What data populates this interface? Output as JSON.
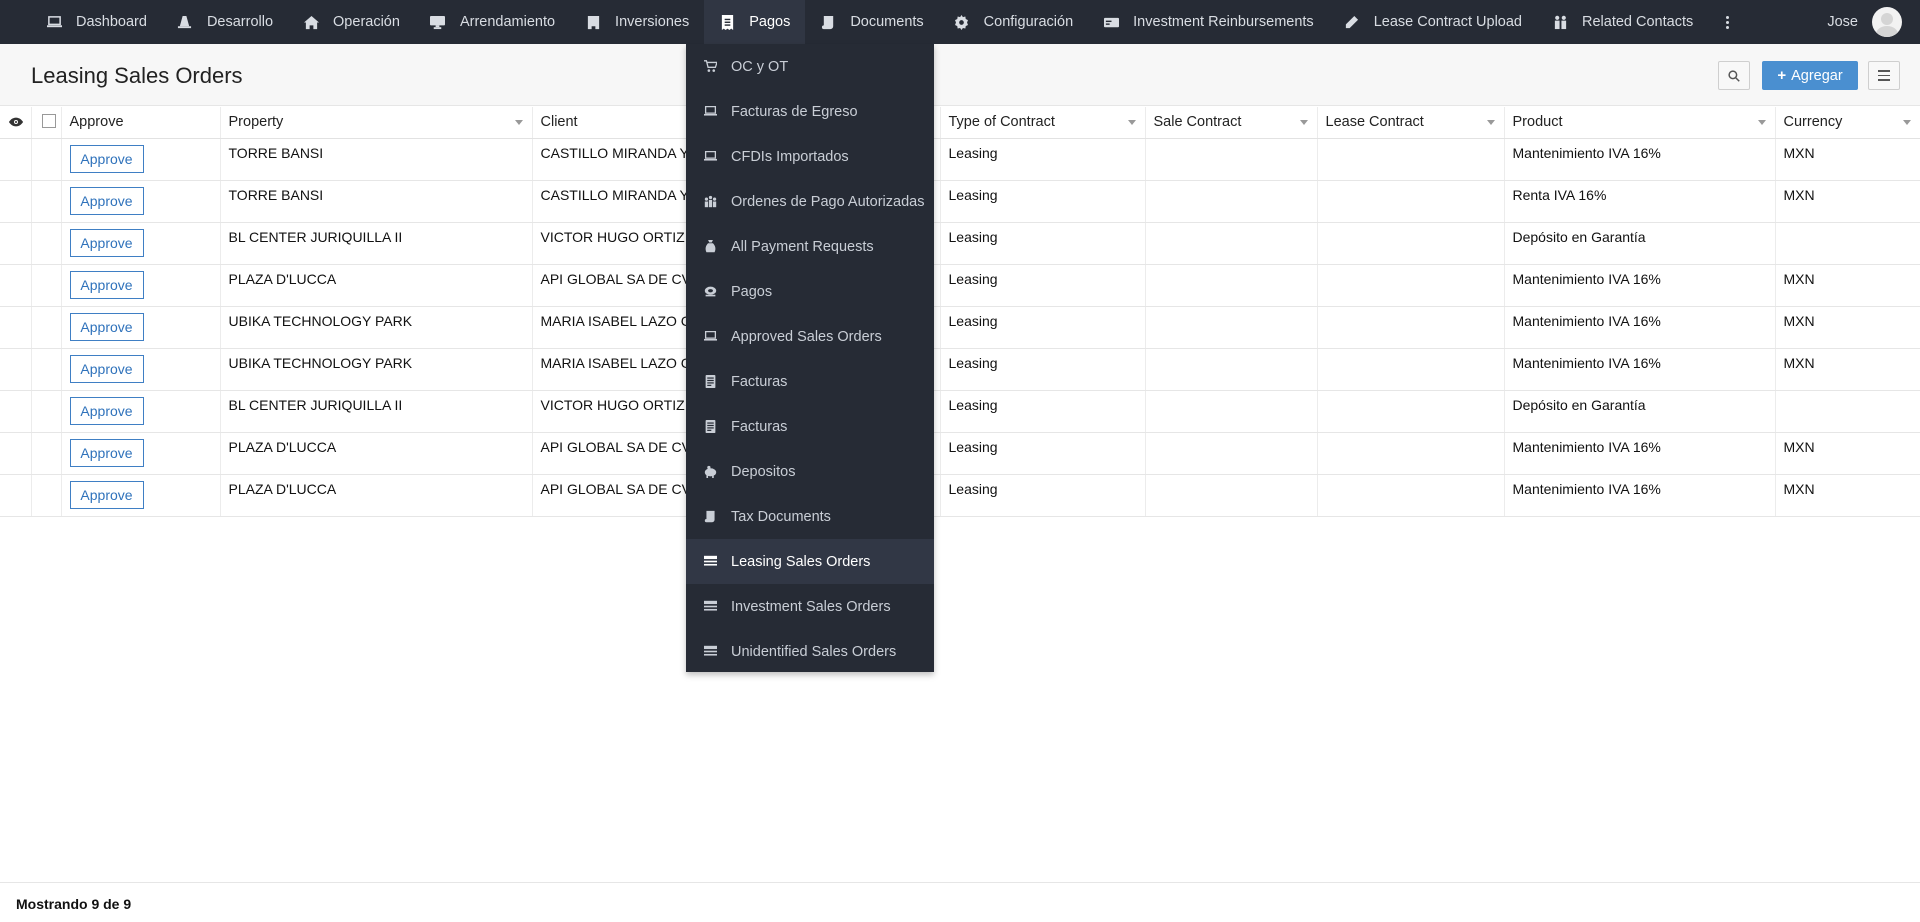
{
  "nav": {
    "items": [
      {
        "label": "Dashboard",
        "icon": "laptop-icon",
        "name": "nav-dashboard"
      },
      {
        "label": "Desarrollo",
        "icon": "cone-icon",
        "name": "nav-desarrollo"
      },
      {
        "label": "Operación",
        "icon": "home-icon",
        "name": "nav-operacion"
      },
      {
        "label": "Arrendamiento",
        "icon": "monitor-icon",
        "name": "nav-arrendamiento"
      },
      {
        "label": "Inversiones",
        "icon": "building-icon",
        "name": "nav-inversiones"
      },
      {
        "label": "Pagos",
        "icon": "receipt-icon",
        "name": "nav-pagos",
        "active": true
      },
      {
        "label": "Documents",
        "icon": "scroll-icon",
        "name": "nav-documents"
      },
      {
        "label": "Configuración",
        "icon": "gear-icon",
        "name": "nav-configuracion"
      },
      {
        "label": "Investment Reinbursements",
        "icon": "money-check-icon",
        "name": "nav-investment-reinbursements"
      },
      {
        "label": "Lease Contract Upload",
        "icon": "pen-icon",
        "name": "nav-lease-contract-upload"
      },
      {
        "label": "Related Contacts",
        "icon": "people-icon",
        "name": "nav-related-contacts"
      }
    ],
    "user_name": "Jose"
  },
  "header": {
    "title": "Leasing Sales Orders",
    "add_label": "Agregar"
  },
  "table": {
    "columns": [
      {
        "key": "approve",
        "label": "Approve",
        "sortable": false
      },
      {
        "key": "property",
        "label": "Property",
        "sortable": true
      },
      {
        "key": "client",
        "label": "Client",
        "sortable": true
      },
      {
        "key": "type",
        "label": "Type of Contract",
        "sortable": true
      },
      {
        "key": "sale",
        "label": "Sale Contract",
        "sortable": true
      },
      {
        "key": "lease",
        "label": "Lease Contract",
        "sortable": true
      },
      {
        "key": "product",
        "label": "Product",
        "sortable": true
      },
      {
        "key": "currency",
        "label": "Currency",
        "sortable": true
      }
    ],
    "approve_label": "Approve",
    "rows": [
      {
        "property": "TORRE BANSI",
        "client": "CASTILLO MIRANDA Y",
        "type": "Leasing",
        "sale": "",
        "lease": "",
        "product": "Mantenimiento IVA 16%",
        "currency": "MXN"
      },
      {
        "property": "TORRE BANSI",
        "client": "CASTILLO MIRANDA Y",
        "type": "Leasing",
        "sale": "",
        "lease": "",
        "product": "Renta IVA 16%",
        "currency": "MXN"
      },
      {
        "property": "BL CENTER JURIQUILLA II",
        "client": "VICTOR HUGO ORTIZ C",
        "type": "Leasing",
        "sale": "",
        "lease": "",
        "product": "Depósito en Garantía",
        "currency": ""
      },
      {
        "property": "PLAZA D'LUCCA",
        "client": "API GLOBAL SA DE CV",
        "type": "Leasing",
        "sale": "",
        "lease": "",
        "product": "Mantenimiento IVA 16%",
        "currency": "MXN"
      },
      {
        "property": "UBIKA TECHNOLOGY PARK",
        "client": "MARIA ISABEL LAZO C",
        "type": "Leasing",
        "sale": "",
        "lease": "",
        "product": "Mantenimiento IVA 16%",
        "currency": "MXN"
      },
      {
        "property": "UBIKA TECHNOLOGY PARK",
        "client": "MARIA ISABEL LAZO C",
        "type": "Leasing",
        "sale": "",
        "lease": "",
        "product": "Mantenimiento IVA 16%",
        "currency": "MXN"
      },
      {
        "property": "BL CENTER JURIQUILLA II",
        "client": "VICTOR HUGO ORTIZ C",
        "type": "Leasing",
        "sale": "",
        "lease": "",
        "product": "Depósito en Garantía",
        "currency": ""
      },
      {
        "property": "PLAZA D'LUCCA",
        "client": "API GLOBAL SA DE CV",
        "type": "Leasing",
        "sale": "",
        "lease": "",
        "product": "Mantenimiento IVA 16%",
        "currency": "MXN"
      },
      {
        "property": "PLAZA D'LUCCA",
        "client": "API GLOBAL SA DE CV",
        "type": "Leasing",
        "sale": "",
        "lease": "",
        "product": "Mantenimiento IVA 16%",
        "currency": "MXN"
      }
    ]
  },
  "footer": {
    "status": "Mostrando 9 de 9"
  },
  "dropdown": {
    "items": [
      {
        "label": "OC y OT",
        "icon": "cart-icon",
        "name": "menu-oc-y-ot"
      },
      {
        "label": "Facturas de Egreso",
        "icon": "laptop-icon",
        "name": "menu-facturas-de-egreso"
      },
      {
        "label": "CFDIs Importados",
        "icon": "laptop-icon",
        "name": "menu-cfdis-importados"
      },
      {
        "label": "Ordenes de Pago Autorizadas",
        "icon": "balance-icon",
        "name": "menu-ordenes-de-pago-autorizadas"
      },
      {
        "label": "All Payment Requests",
        "icon": "money-bag-icon",
        "name": "menu-all-payment-requests"
      },
      {
        "label": "Pagos",
        "icon": "cash-icon",
        "name": "menu-pagos"
      },
      {
        "label": "Approved Sales Orders",
        "icon": "laptop-icon",
        "name": "menu-approved-sales-orders"
      },
      {
        "label": "Facturas",
        "icon": "invoice-icon",
        "name": "menu-facturas-1"
      },
      {
        "label": "Facturas",
        "icon": "invoice-icon",
        "name": "menu-facturas-2"
      },
      {
        "label": "Depositos",
        "icon": "piggy-bank-icon",
        "name": "menu-depositos"
      },
      {
        "label": "Tax Documents",
        "icon": "scroll-icon",
        "name": "menu-tax-documents"
      },
      {
        "label": "Leasing Sales Orders",
        "icon": "list-icon",
        "name": "menu-leasing-sales-orders",
        "active": true
      },
      {
        "label": "Investment Sales Orders",
        "icon": "list-icon",
        "name": "menu-investment-sales-orders"
      },
      {
        "label": "Unidentified Sales Orders",
        "icon": "list-icon",
        "name": "menu-unidentified-sales-orders"
      }
    ]
  },
  "colors": {
    "nav_bg": "#262b35",
    "accent": "#4a8fd0",
    "approve_border": "#3f7fc4"
  }
}
